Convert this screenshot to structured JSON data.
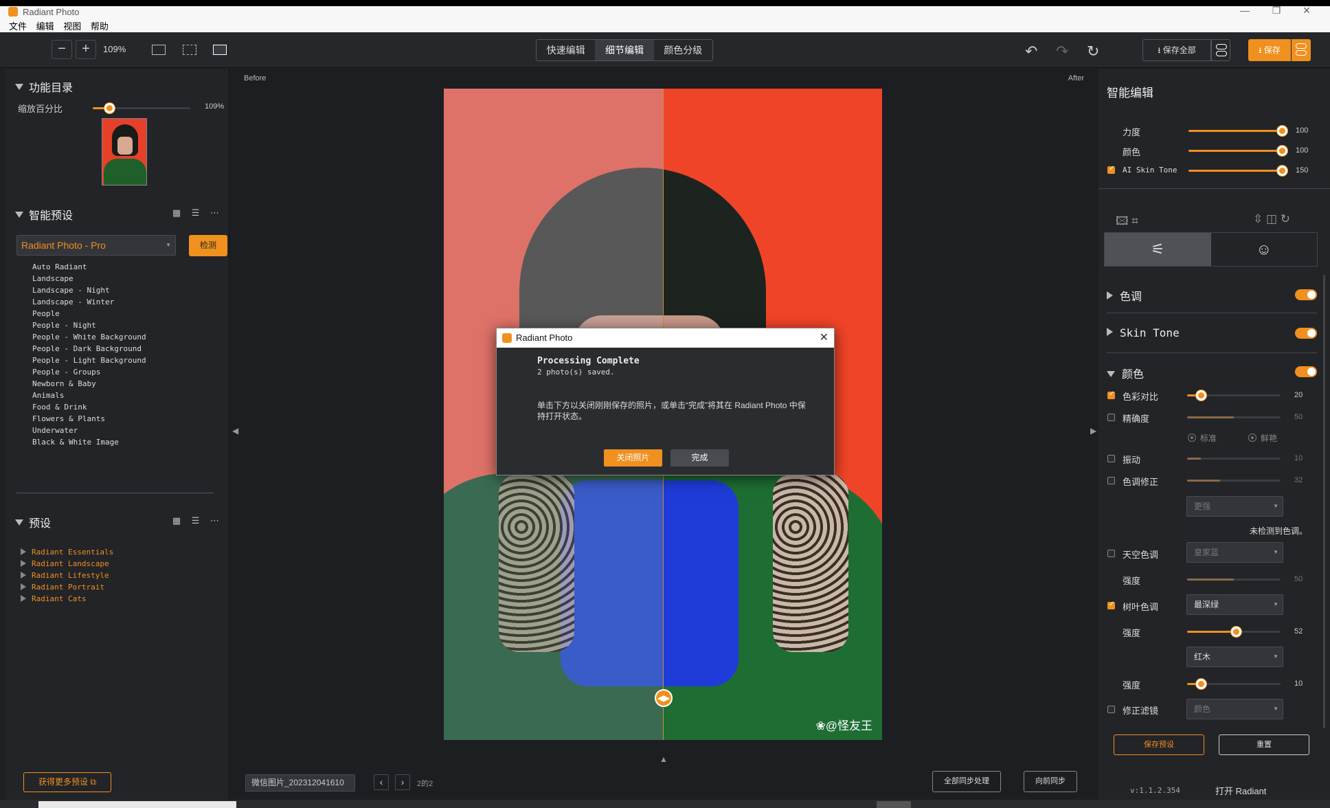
{
  "window": {
    "title": "Radiant Photo",
    "controls": [
      "—",
      "❐",
      "✕"
    ]
  },
  "menu": [
    "文件",
    "编辑",
    "视图",
    "帮助"
  ],
  "toolbar": {
    "zoom_minus": "−",
    "zoom_plus": "+",
    "zoom_value": "109%",
    "modes": [
      "快速编辑",
      "细节编辑",
      "颜色分级"
    ],
    "active_mode": "细节编辑",
    "undo": "↶",
    "redo": "↷",
    "reset": "↻",
    "save_all": "⭳ 保存全部",
    "save": "⭳ 保存"
  },
  "left": {
    "catalog_title": "功能目录",
    "zoom_label": "缩放百分比",
    "zoom_value": "109%",
    "zoom_fraction": 0.17,
    "smart_preset_title": "智能预设",
    "preset_dropdown": "Radiant Photo - Pro",
    "detect_button": "检测",
    "smart_items": [
      "Auto Radiant",
      "Landscape",
      "Landscape - Night",
      "Landscape - Winter",
      "People",
      "People - Night",
      "People - White Background",
      "People - Dark Background",
      "People - Light Background",
      "People - Groups",
      "Newborn & Baby",
      "Animals",
      "Food & Drink",
      "Flowers & Plants",
      "Underwater",
      "Black & White Image"
    ],
    "presets_title": "预设",
    "preset_groups": [
      "Radiant Essentials",
      "Radiant Landscape",
      "Radiant Lifestyle",
      "Radiant Portrait",
      "Radiant Cats"
    ],
    "more_presets": "获得更多预设 ⧉",
    "header_icons": "▦ ☰ ⋯"
  },
  "canvas": {
    "before_label": "Before",
    "after_label": "After",
    "watermark": "❀@怪友王",
    "split_knob": "◀▶",
    "left_arrow": "◀",
    "right_arrow": "▶",
    "up_arrow": "▲",
    "file_name": "微信图片_202312041610",
    "prev": "‹",
    "next": "›",
    "page_count": "2的2",
    "sync_all": "全部同步处理",
    "sync_prev": "向前同步"
  },
  "dialog": {
    "title": "Radiant Photo",
    "close": "✕",
    "heading": "Processing Complete",
    "subheading": "2 photo(s) saved.",
    "message": "单击下方以关闭刚刚保存的照片，或单击“完成”将其在 Radiant Photo 中保持打开状态。",
    "close_photos_button": "关闭照片",
    "done_button": "完成"
  },
  "right": {
    "smart_edit_title": "智能编辑",
    "strength_label": "力度",
    "strength_value": "100",
    "strength_fraction": 1.0,
    "color_label": "颜色",
    "color_value": "100",
    "color_fraction": 1.0,
    "ai_skin_label": "AI Skin Tone",
    "ai_skin_value": "150",
    "ai_skin_fraction": 1.0,
    "tool_icons_left": "🖾 ⌗",
    "tool_icons_right": "⇳ ◫ ↻",
    "tab_adjust": "⚟",
    "tab_portrait": "☺",
    "sect_tone": "色调",
    "sect_skin": "Skin Tone",
    "sect_color": "颜色",
    "contrast_label": "色彩对比",
    "contrast_value": "20",
    "contrast_fraction": 0.15,
    "precision_label": "精确度",
    "precision_value": "50",
    "precision_fraction": 0.5,
    "radio_standard": "标准",
    "radio_vivid": "鲜艳",
    "vibrance_label": "振动",
    "vibrance_value": "10",
    "vibrance_fraction": 0.15,
    "tint_label": "色调修正",
    "tint_value": "32",
    "tint_fraction": 0.35,
    "tint_select": "更强",
    "no_cast": "未检测到色调。",
    "sky_label": "天空色调",
    "sky_select": "皇家蓝",
    "sky_strength_label": "强度",
    "sky_strength_value": "50",
    "sky_strength_fraction": 0.5,
    "foliage_label": "树叶色调",
    "foliage_select": "最深绿",
    "foliage_strength_label": "强度",
    "foliage_strength_value": "52",
    "foliage_strength_fraction": 0.52,
    "wood_select": "红木",
    "wood_strength_label": "强度",
    "wood_strength_value": "10",
    "wood_strength_fraction": 0.15,
    "filter_label": "修正滤镜",
    "filter_select": "颜色",
    "save_preset": "保存预设",
    "reset": "重置",
    "version": "v:1.1.2.354",
    "open_radiant": "打开 Radiant"
  },
  "colors": {
    "accent": "#f0901f",
    "background": "#1f2024",
    "panel": "#232428"
  }
}
